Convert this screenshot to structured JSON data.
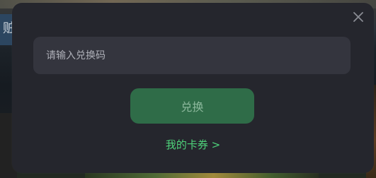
{
  "background": {
    "edge_glyph": "赃"
  },
  "modal": {
    "close_icon": "close-icon",
    "input": {
      "placeholder": "请输入兑换码",
      "value": ""
    },
    "redeem_label": "兑换",
    "my_coupons_label": "我的卡券 >",
    "colors": {
      "modal_bg": "#25262d",
      "input_bg": "#34353e",
      "button_bg": "#2f6c48",
      "button_text": "#8cb89c",
      "link_text": "#4ed27a"
    }
  }
}
